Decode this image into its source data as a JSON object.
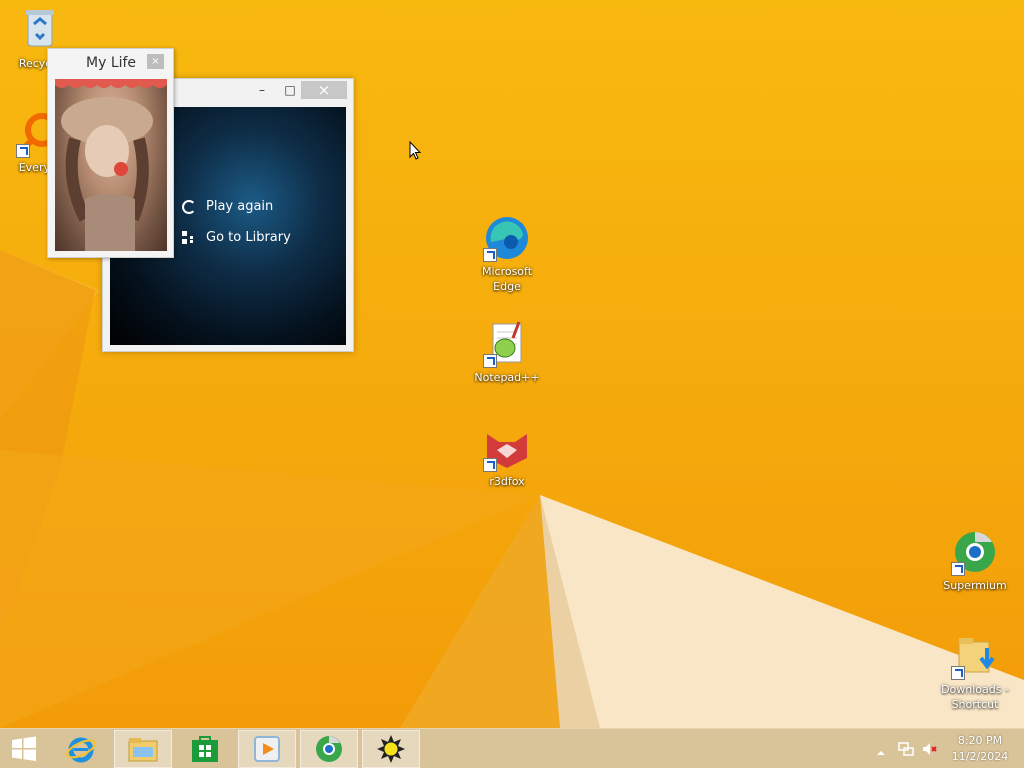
{
  "desktop": {
    "icons": [
      {
        "label": "Recycle",
        "icon": "recycle-bin-icon"
      },
      {
        "label": "Everyth",
        "icon": "everything-search-icon"
      },
      {
        "label": "Microsoft Edge",
        "icon": "microsoft-edge-icon"
      },
      {
        "label": "Notepad++",
        "icon": "notepad-plus-plus-icon"
      },
      {
        "label": "r3dfox",
        "icon": "r3dfox-icon"
      },
      {
        "label": "Supermium",
        "icon": "supermium-icon"
      },
      {
        "label": "Downloads - Shortcut",
        "icon": "downloads-folder-icon"
      }
    ]
  },
  "player": {
    "actions": [
      {
        "label": "Play again",
        "icon": "replay-icon"
      },
      {
        "label": "Go to Library",
        "icon": "library-icon"
      }
    ]
  },
  "widget": {
    "title": "My Life",
    "close_glyph": "×"
  },
  "taskbar": {
    "items": [
      {
        "name": "start-button",
        "icon": "windows-logo-icon"
      },
      {
        "name": "internet-explorer",
        "icon": "internet-explorer-icon"
      },
      {
        "name": "file-explorer",
        "icon": "file-explorer-icon"
      },
      {
        "name": "store",
        "icon": "store-icon"
      },
      {
        "name": "media-player",
        "icon": "media-player-icon"
      },
      {
        "name": "supermium",
        "icon": "supermium-icon"
      },
      {
        "name": "sun-app",
        "icon": "sun-icon"
      }
    ],
    "clock": {
      "time": "8:20 PM",
      "date": "11/2/2024"
    }
  },
  "colors": {
    "desktop_bg": "#f5a90c",
    "taskbar_bg": "#d9c49a",
    "close_btn": "#c7c7c7"
  }
}
